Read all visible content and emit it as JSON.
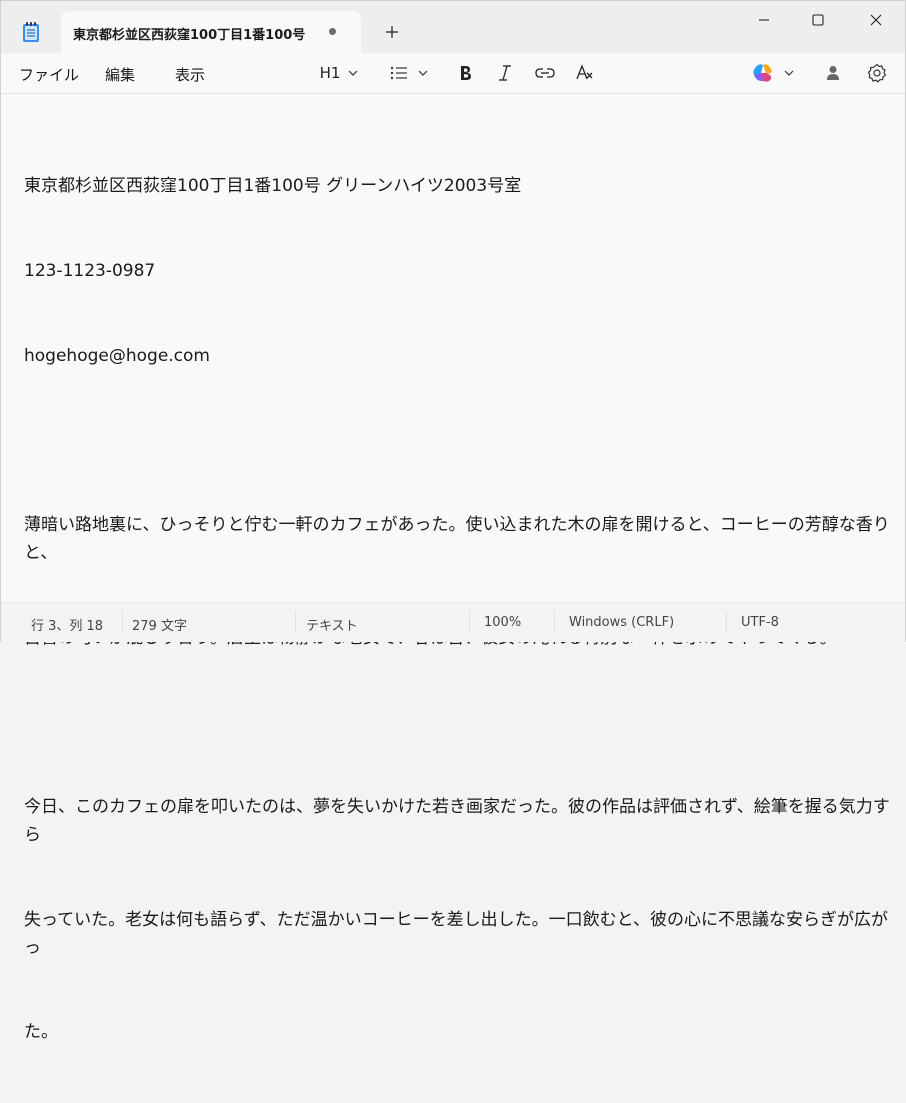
{
  "tab": {
    "title": "東京都杉並区西荻窪100丁目1番100号"
  },
  "menu": {
    "file": "ファイル",
    "edit": "編集",
    "view": "表示"
  },
  "toolbar": {
    "heading": "H1",
    "icons": [
      "list-icon",
      "bold-icon",
      "italic-icon",
      "link-icon",
      "clear-format-icon",
      "copilot-icon",
      "account-icon",
      "settings-icon"
    ]
  },
  "document": {
    "lines": [
      "東京都杉並区西荻窪100丁目1番100号 グリーンハイツ2003号室",
      "123-1123-0987",
      "hogehoge@hoge.com",
      "",
      "薄暗い路地裏に、ひっそりと佇む一軒のカフェがあった。使い込まれた木の扉を開けると、コーヒーの芳醇な香りと、",
      "古書の匂いが混じり合う。店主は物静かな老女で、客は皆、彼女の淹れる特別な一杯を求めてやってくる。",
      "",
      "今日、このカフェの扉を叩いたのは、夢を失いかけた若き画家だった。彼の作品は評価されず、絵筆を握る気力すら",
      "失っていた。老女は何も語らず、ただ温かいコーヒーを差し出した。一口飲むと、彼の心に不思議な安らぎが広がっ",
      "た。"
    ]
  },
  "status": {
    "position": "行 3、列 18",
    "chars": "279 文字",
    "mode": "テキスト",
    "zoom": "100%",
    "line_ending": "Windows (CRLF)",
    "encoding": "UTF-8"
  }
}
